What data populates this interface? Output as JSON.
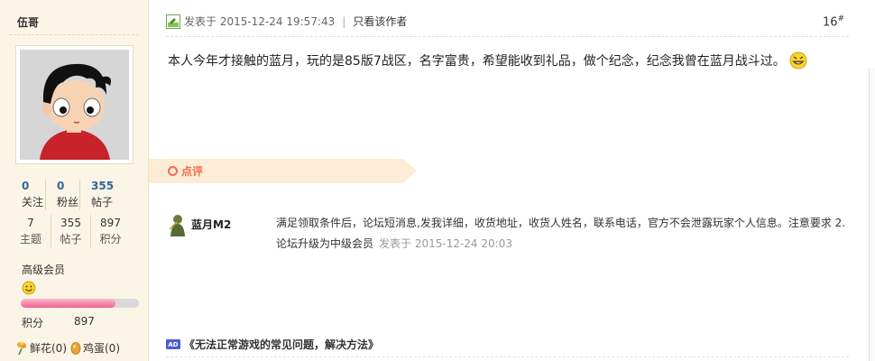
{
  "user": {
    "name": "伍哥",
    "stats_primary": [
      {
        "value": "0",
        "label": "关注"
      },
      {
        "value": "0",
        "label": "粉丝"
      },
      {
        "value": "355",
        "label": "帖子"
      }
    ],
    "stats_secondary": [
      {
        "value": "7",
        "label": "主题"
      },
      {
        "value": "355",
        "label": "帖子"
      },
      {
        "value": "897",
        "label": "积分"
      }
    ],
    "group": "高级会员",
    "level_progress": 0.8,
    "level_bar_color": "#f0608f",
    "credit_label": "积分",
    "credit_value": "897",
    "gifts": [
      {
        "icon": "flower-icon",
        "label": "鲜花(0)"
      },
      {
        "icon": "egg-icon",
        "label": "鸡蛋(0)"
      }
    ]
  },
  "post": {
    "posted_label": "发表于 2015-12-24 19:57:43",
    "only_author": "只看该作者",
    "floor": "16",
    "floor_mark": "#",
    "content": "本人今年才接触的蓝月，玩的是85版7战区，名字富贵，希望能收到礼品，做个纪念，纪念我曾在蓝月战斗过。"
  },
  "review": {
    "label": "点评",
    "accent_color": "#f26c4f",
    "reviewer": "蓝月M2",
    "text": "满足领取条件后，论坛短消息,发我详细，收货地址，收货人姓名，联系电话，官方不会泄露玩家个人信息。注意要求 2.论坛升级为中级会员",
    "date": "发表于 2015-12-24 20:03"
  },
  "ad": {
    "tag": "AD",
    "text": "《无法正常游戏的常见问题，解决方法》"
  }
}
